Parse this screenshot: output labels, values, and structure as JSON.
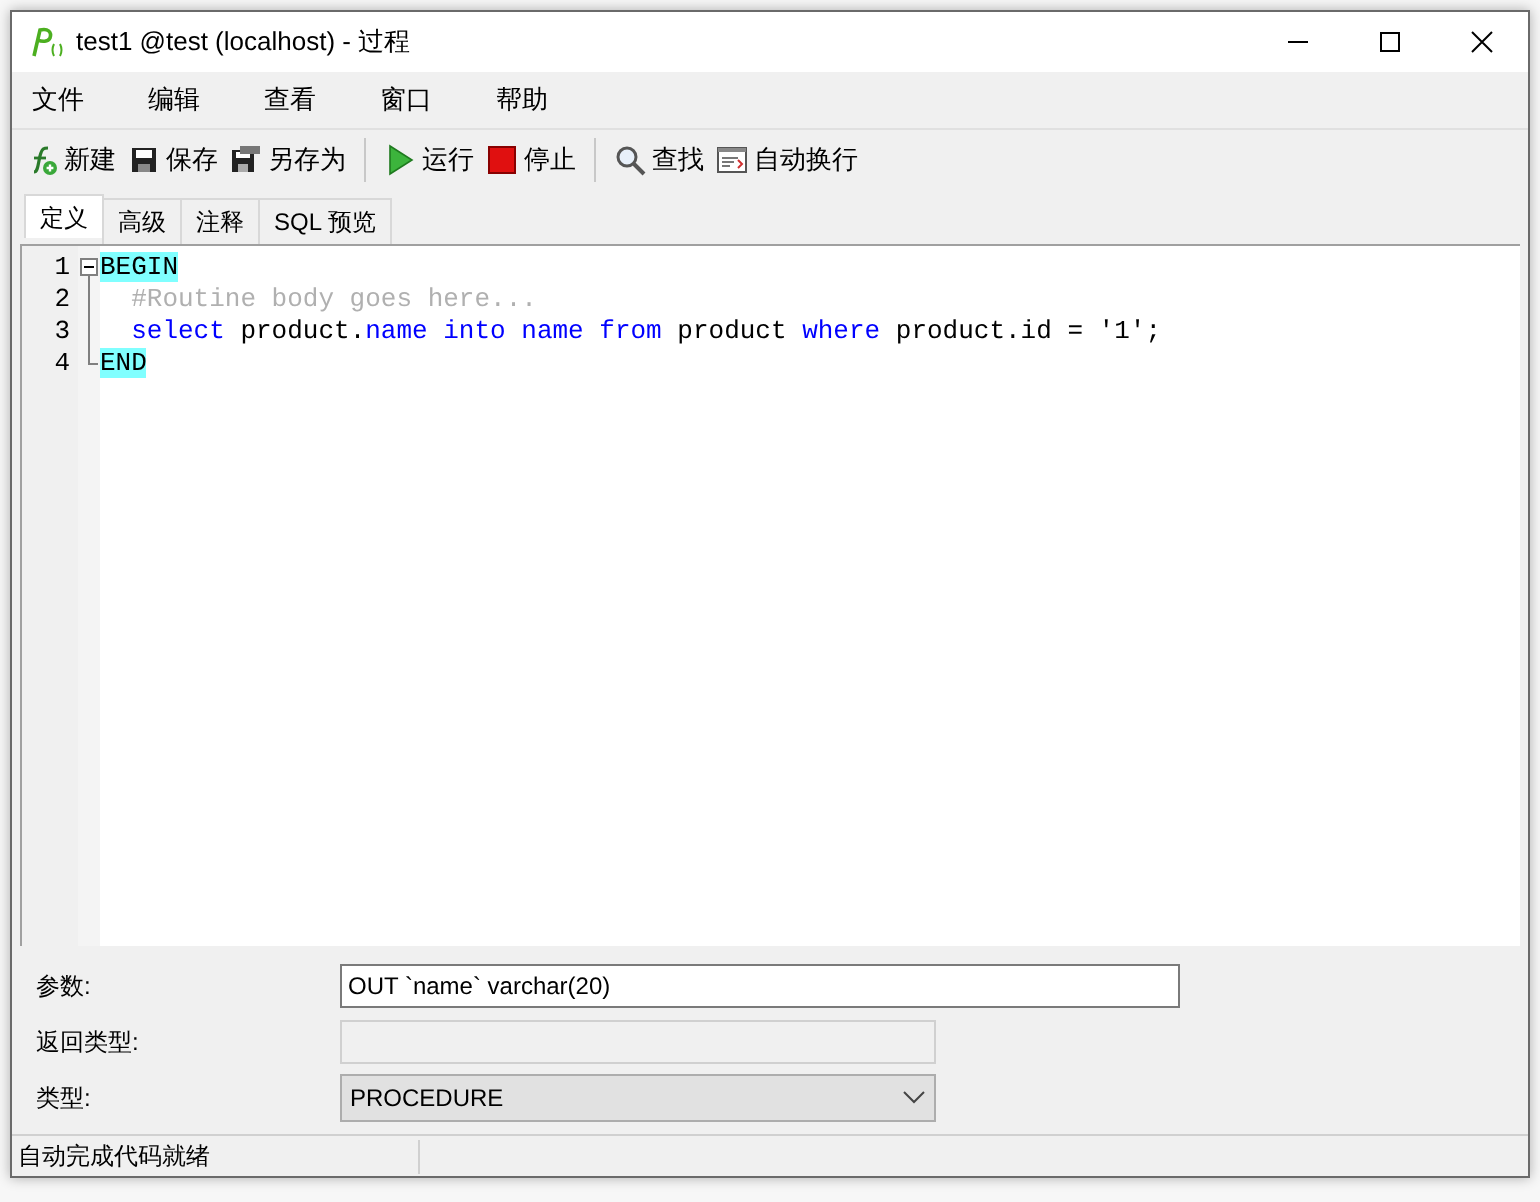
{
  "window": {
    "title": "test1 @test (localhost) - 过程"
  },
  "menu": [
    "文件",
    "编辑",
    "查看",
    "窗口",
    "帮助"
  ],
  "toolbar": [
    {
      "kind": "new",
      "label": "新建"
    },
    {
      "kind": "save",
      "label": "保存"
    },
    {
      "kind": "save-as",
      "label": "另存为"
    },
    {
      "kind": "separator"
    },
    {
      "kind": "run",
      "label": "运行"
    },
    {
      "kind": "stop",
      "label": "停止"
    },
    {
      "kind": "separator"
    },
    {
      "kind": "find",
      "label": "查找"
    },
    {
      "kind": "wrap",
      "label": "自动换行"
    }
  ],
  "tabs": [
    {
      "label": "定义",
      "selected": true
    },
    {
      "label": "高级",
      "selected": false
    },
    {
      "label": "注释",
      "selected": false
    },
    {
      "label": "SQL 预览",
      "selected": false
    }
  ],
  "editor": {
    "lines": [
      {
        "number": "1",
        "tokens": [
          {
            "kind": "matched",
            "text": "BEGIN"
          }
        ]
      },
      {
        "number": "2",
        "indented": true,
        "tokens": [
          {
            "kind": "comment",
            "text": "#Routine body goes here..."
          }
        ]
      },
      {
        "number": "3",
        "indented": true,
        "tokens": [
          {
            "kind": "keyword",
            "text": "select"
          },
          {
            "kind": "plain",
            "text": " product."
          },
          {
            "kind": "keyword",
            "text": "name into name from"
          },
          {
            "kind": "plain",
            "text": " product "
          },
          {
            "kind": "keyword",
            "text": "where"
          },
          {
            "kind": "plain",
            "text": " product.id = '1';"
          }
        ]
      },
      {
        "number": "4",
        "tokens": [
          {
            "kind": "matched",
            "text": "END"
          }
        ]
      }
    ]
  },
  "form": [
    {
      "kind": "text",
      "label": "参数:",
      "value": "OUT `name` varchar(20)"
    },
    {
      "kind": "disabled",
      "label": "返回类型:"
    },
    {
      "kind": "dropdown",
      "label": "类型:",
      "value": "PROCEDURE"
    }
  ],
  "status_bar": {
    "text": "自动完成代码就绪"
  }
}
